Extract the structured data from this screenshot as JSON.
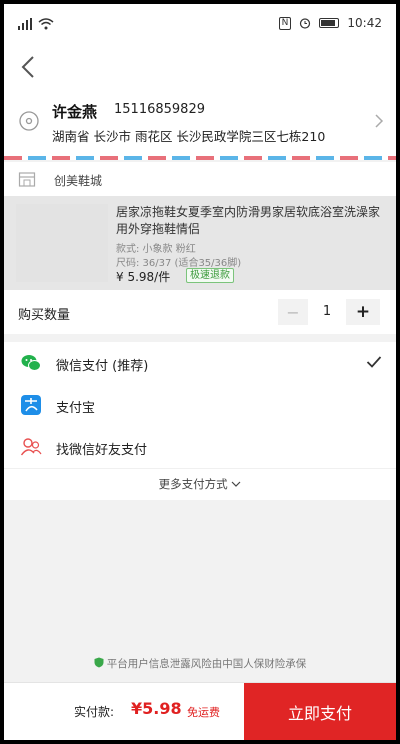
{
  "status_bar": {
    "time": "10:42",
    "nfc": "N",
    "icons": [
      "signal-icon",
      "wifi-icon",
      "nfc-icon",
      "alarm-icon",
      "battery-icon"
    ]
  },
  "address": {
    "name": "许金燕",
    "phone": "15116859829",
    "detail": "湖南省 长沙市 雨花区 长沙民政学院三区七栋210"
  },
  "shop": {
    "name": "创美鞋城"
  },
  "product": {
    "title": "居家凉拖鞋女夏季室内防滑男家居软底浴室洗澡家用外穿拖鞋情侣",
    "style": "款式: 小象款 粉红",
    "size": "尺码: 36/37 (适合35/36脚)",
    "price": "¥ 5.98/件",
    "badge": "极速退款"
  },
  "quantity": {
    "label": "购买数量",
    "value": "1",
    "minus": "−",
    "plus": "+"
  },
  "payment": {
    "methods": [
      {
        "label": "微信支付 (推荐)",
        "icon": "wechat-pay-icon",
        "selected": true
      },
      {
        "label": "支付宝",
        "icon": "alipay-icon",
        "selected": false
      },
      {
        "label": "找微信好友支付",
        "icon": "friend-pay-icon",
        "selected": false
      }
    ],
    "more": "更多支付方式"
  },
  "insurance": "平台用户信息泄露风险由中国人保财险承保",
  "footer": {
    "total_label": "实付款:",
    "total_amount": "¥5.98",
    "shipping": "免运费",
    "pay_button": "立即支付"
  },
  "colors": {
    "accent_red": "#e02525",
    "wechat_green": "#22b14c",
    "alipay_blue": "#1e8ee8"
  }
}
